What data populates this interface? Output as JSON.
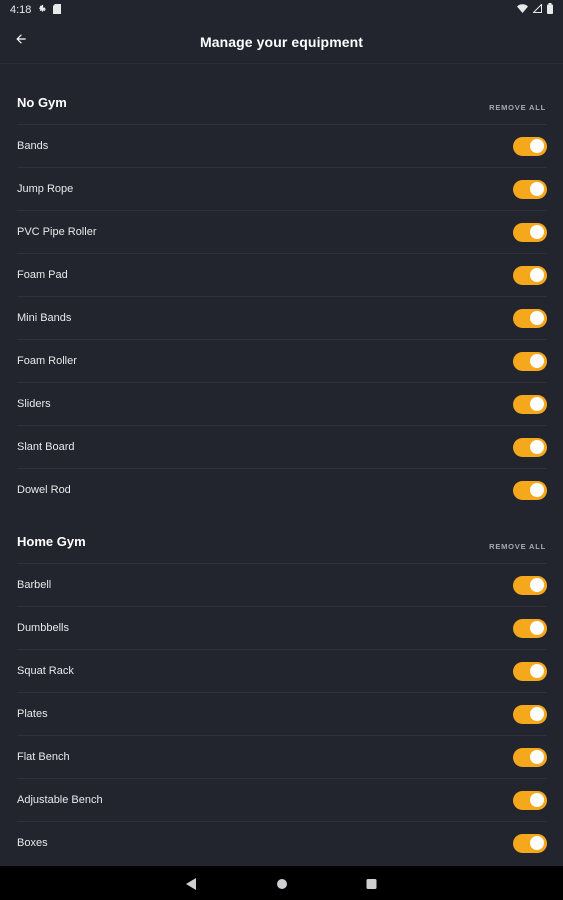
{
  "status_bar": {
    "time": "4:18"
  },
  "app_bar": {
    "title": "Manage your equipment"
  },
  "sections": [
    {
      "title": "No Gym",
      "remove_all_label": "REMOVE ALL",
      "items": [
        {
          "label": "Bands",
          "enabled": true
        },
        {
          "label": "Jump Rope",
          "enabled": true
        },
        {
          "label": "PVC Pipe Roller",
          "enabled": true
        },
        {
          "label": "Foam Pad",
          "enabled": true
        },
        {
          "label": "Mini Bands",
          "enabled": true
        },
        {
          "label": "Foam Roller",
          "enabled": true
        },
        {
          "label": "Sliders",
          "enabled": true
        },
        {
          "label": "Slant Board",
          "enabled": true
        },
        {
          "label": "Dowel Rod",
          "enabled": true
        }
      ]
    },
    {
      "title": "Home Gym",
      "remove_all_label": "REMOVE ALL",
      "items": [
        {
          "label": "Barbell",
          "enabled": true
        },
        {
          "label": "Dumbbells",
          "enabled": true
        },
        {
          "label": "Squat Rack",
          "enabled": true
        },
        {
          "label": "Plates",
          "enabled": true
        },
        {
          "label": "Flat Bench",
          "enabled": true
        },
        {
          "label": "Adjustable Bench",
          "enabled": true
        },
        {
          "label": "Boxes",
          "enabled": true
        }
      ]
    }
  ],
  "colors": {
    "background": "#22252e",
    "toggle_on": "#f6a81d",
    "divider": "#2e313a",
    "nav_bar": "#000000"
  },
  "icons": {
    "back": "arrow-left-icon",
    "settings": "gear-icon",
    "sim": "sim-card-icon",
    "wifi": "wifi-icon",
    "signal": "signal-icon",
    "battery": "battery-icon",
    "nav_back": "triangle-back-icon",
    "nav_home": "circle-home-icon",
    "nav_recents": "square-recents-icon"
  }
}
